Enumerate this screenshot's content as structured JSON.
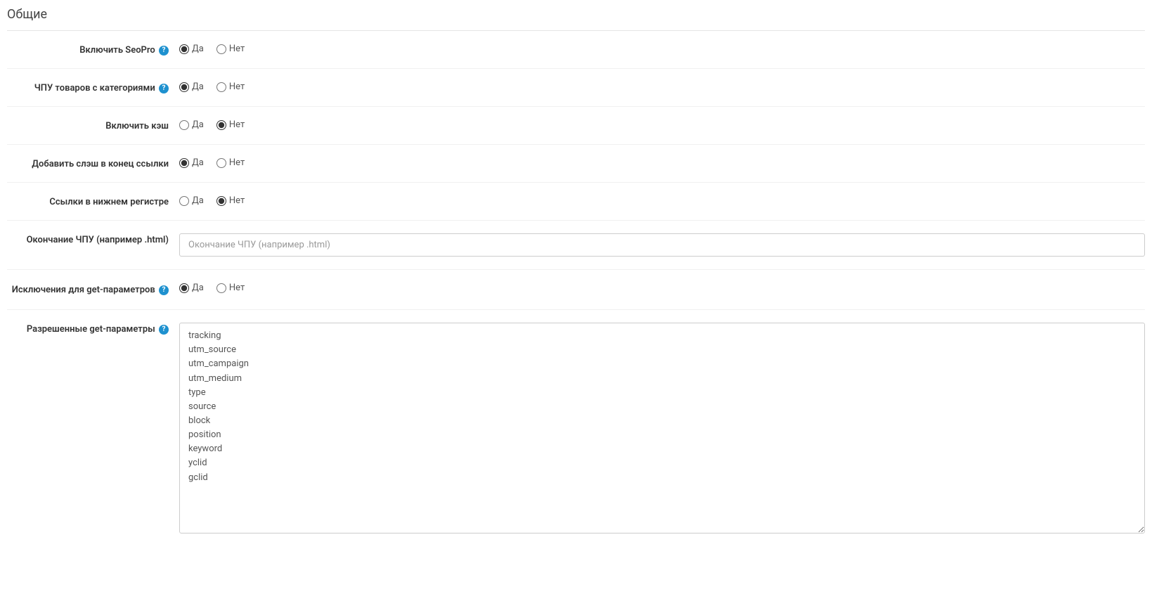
{
  "section_title": "Общие",
  "yes_label": "Да",
  "no_label": "Нет",
  "rows": {
    "enable_seopro": {
      "label": "Включить SeoPro",
      "has_help": true,
      "selected": "yes"
    },
    "product_urls_with_categories": {
      "label": "ЧПУ товаров с категориями",
      "has_help": true,
      "selected": "yes"
    },
    "enable_cache": {
      "label": "Включить кэш",
      "has_help": false,
      "selected": "no"
    },
    "add_trailing_slash": {
      "label": "Добавить слэш в конец ссылки",
      "has_help": false,
      "selected": "yes"
    },
    "lowercase_urls": {
      "label": "Ссылки в нижнем регистре",
      "has_help": false,
      "selected": "no"
    },
    "url_ending": {
      "label": "Окончание ЧПУ (например .html)",
      "placeholder": "Окончание ЧПУ (например .html)",
      "value": ""
    },
    "get_param_exceptions": {
      "label": "Исключения для get-параметров",
      "has_help": true,
      "selected": "yes"
    },
    "allowed_get_params": {
      "label": "Разрешенные get-параметры",
      "has_help": true,
      "value": "tracking\nutm_source\nutm_campaign\nutm_medium\ntype\nsource\nblock\nposition\nkeyword\nyclid\ngclid"
    }
  }
}
